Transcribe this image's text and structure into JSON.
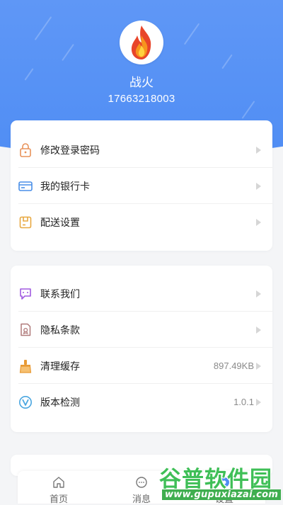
{
  "profile": {
    "name": "战火",
    "phone": "17663218003"
  },
  "menu_group_1": [
    {
      "label": "修改登录密码",
      "icon": "lock-icon",
      "color": "#e8925a"
    },
    {
      "label": "我的银行卡",
      "icon": "bank-card-icon",
      "color": "#4a8fe8"
    },
    {
      "label": "配送设置",
      "icon": "delivery-box-icon",
      "color": "#e8a840"
    }
  ],
  "menu_group_2": [
    {
      "label": "联系我们",
      "icon": "chat-bubble-icon",
      "color": "#a05ae0",
      "value": ""
    },
    {
      "label": "隐私条款",
      "icon": "document-icon",
      "color": "#b07a7a",
      "value": ""
    },
    {
      "label": "清理缓存",
      "icon": "broom-icon",
      "color": "#e89a35",
      "value": "897.49KB"
    },
    {
      "label": "版本检测",
      "icon": "version-v-icon",
      "color": "#4aa6e0",
      "value": "1.0.1"
    }
  ],
  "tabbar": {
    "home_label": "首页",
    "messages_label": "消息",
    "settings_label": "设置"
  },
  "watermark": {
    "title": "谷普软件园",
    "url": "www.gupuxiazai.com"
  },
  "colors": {
    "header_blue": "#4f8df4",
    "background": "#f4f5f7",
    "watermark_green": "#3fbf57"
  }
}
